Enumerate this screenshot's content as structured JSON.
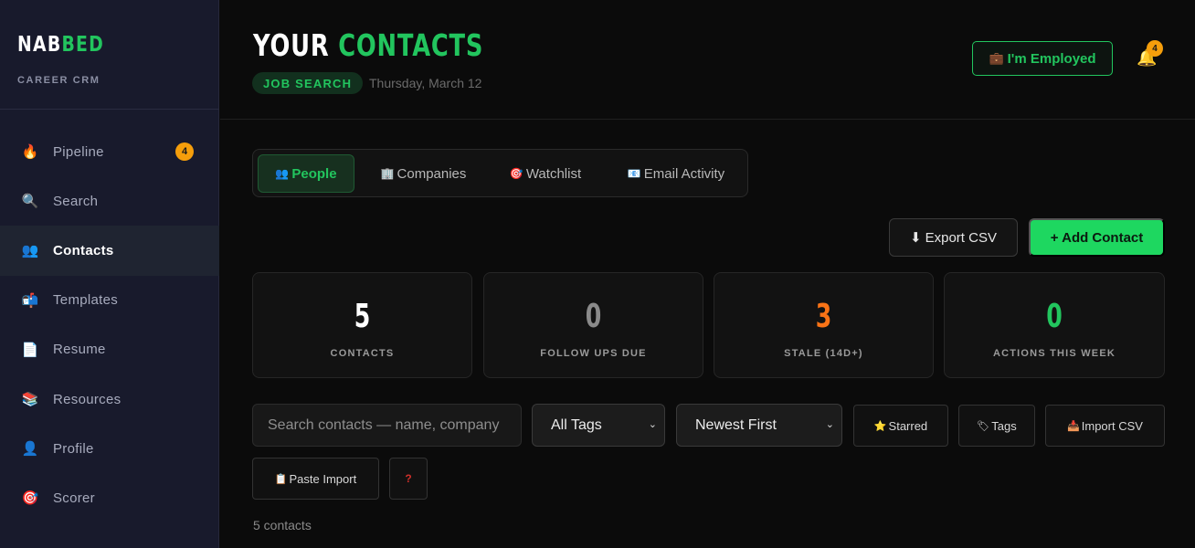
{
  "brand": {
    "part1": "NAB",
    "part2": "BED",
    "subtitle": "CAREER CRM"
  },
  "sidebar": {
    "items": [
      {
        "icon": "🔥",
        "icon_name": "fire-icon",
        "label": "Pipeline",
        "badge": "4"
      },
      {
        "icon": "🔍",
        "icon_name": "magnifier-icon",
        "label": "Search"
      },
      {
        "icon": "👥",
        "icon_name": "people-icon",
        "label": "Contacts",
        "active": true
      },
      {
        "icon": "📬",
        "icon_name": "mailbox-icon",
        "label": "Templates"
      },
      {
        "icon": "📄",
        "icon_name": "document-icon",
        "label": "Resume"
      },
      {
        "icon": "📚",
        "icon_name": "books-icon",
        "label": "Resources"
      },
      {
        "icon": "👤",
        "icon_name": "person-icon",
        "label": "Profile"
      },
      {
        "icon": "🎯",
        "icon_name": "target-icon",
        "label": "Scorer"
      }
    ]
  },
  "header": {
    "title_part1": "YOUR",
    "title_part2": "CONTACTS",
    "mode": "JOB SEARCH",
    "date": "Thursday, March 12",
    "employed_icon": "💼",
    "employed_label": "I'm Employed",
    "bell_icon": "🔔",
    "notification_count": "4"
  },
  "tabs": [
    {
      "icon": "👥",
      "icon_name": "people-icon",
      "label": "People",
      "active": true
    },
    {
      "icon": "🏢",
      "icon_name": "building-icon",
      "label": "Companies"
    },
    {
      "icon": "🎯",
      "icon_name": "target-icon",
      "label": "Watchlist"
    },
    {
      "icon": "📧",
      "icon_name": "email-icon",
      "label": "Email Activity"
    }
  ],
  "actions": {
    "export_icon": "⬇",
    "export_label": "Export CSV",
    "add_label": "+ Add Contact"
  },
  "stats": [
    {
      "value": "5",
      "label": "CONTACTS",
      "color": "#ffffff"
    },
    {
      "value": "0",
      "label": "FOLLOW UPS DUE",
      "color": "#8a8a8a"
    },
    {
      "value": "3",
      "label": "STALE (14D+)",
      "color": "#f97316"
    },
    {
      "value": "0",
      "label": "ACTIONS THIS WEEK",
      "color": "#22c55e"
    }
  ],
  "filters": {
    "search_placeholder": "Search contacts — name, company",
    "tag_select": "All Tags",
    "sort_select": "Newest First",
    "starred_icon": "⭐",
    "starred_label": "Starred",
    "tags_icon": "🏷",
    "tags_label": "Tags",
    "import_icon": "📥",
    "import_label": "Import CSV",
    "paste_icon": "📋",
    "paste_label": "Paste Import",
    "help_label": "?"
  },
  "count_text": "5 contacts",
  "colors": {
    "accent": "#22c55e",
    "warning": "#f59e0b",
    "stale": "#f97316",
    "sidebar_bg": "#181a2c"
  }
}
